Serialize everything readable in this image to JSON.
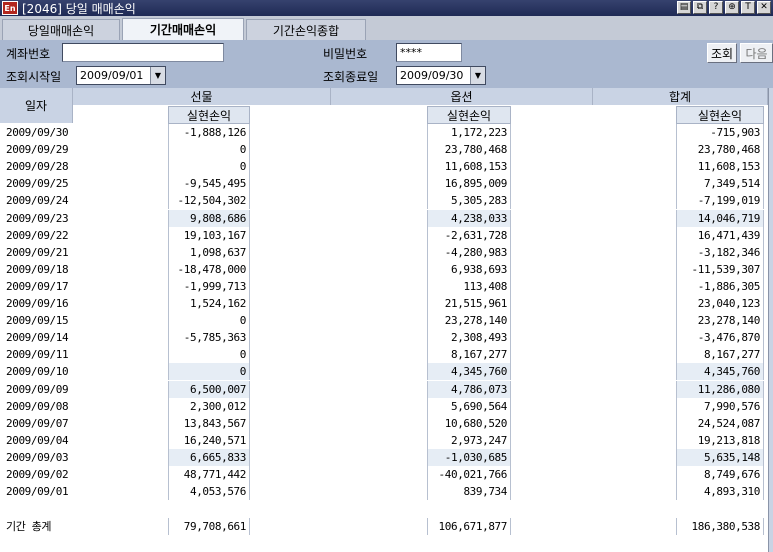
{
  "window": {
    "title": "[2046] 당일 매매손익",
    "logo": "En"
  },
  "tabs": [
    {
      "label": "당일매매손익"
    },
    {
      "label": "기간매매손익"
    },
    {
      "label": "기간손익종합"
    }
  ],
  "form": {
    "account_label": "계좌번호",
    "account_value": "",
    "password_label": "비밀번호",
    "password_value": "****",
    "start_label": "조회시작일",
    "start_value": "2009/09/01",
    "end_label": "조회종료일",
    "end_value": "2009/09/30",
    "search_button": "조회",
    "next_button": "다음"
  },
  "table": {
    "date_header": "일자",
    "group_headers": [
      "선물",
      "옵션",
      "합계"
    ],
    "sub_header": "실현손익",
    "rows": [
      {
        "date": "2009/09/30",
        "futures": "-1,888,126",
        "options": "1,172,223",
        "total": "-715,903"
      },
      {
        "date": "2009/09/29",
        "futures": "0",
        "options": "23,780,468",
        "total": "23,780,468"
      },
      {
        "date": "2009/09/28",
        "futures": "0",
        "options": "11,608,153",
        "total": "11,608,153"
      },
      {
        "date": "2009/09/25",
        "futures": "-9,545,495",
        "options": "16,895,009",
        "total": "7,349,514"
      },
      {
        "date": "2009/09/24",
        "futures": "-12,504,302",
        "options": "5,305,283",
        "total": "-7,199,019"
      },
      {
        "date": "2009/09/23",
        "futures": "9,808,686",
        "options": "4,238,033",
        "total": "14,046,719"
      },
      {
        "date": "2009/09/22",
        "futures": "19,103,167",
        "options": "-2,631,728",
        "total": "16,471,439"
      },
      {
        "date": "2009/09/21",
        "futures": "1,098,637",
        "options": "-4,280,983",
        "total": "-3,182,346"
      },
      {
        "date": "2009/09/18",
        "futures": "-18,478,000",
        "options": "6,938,693",
        "total": "-11,539,307"
      },
      {
        "date": "2009/09/17",
        "futures": "-1,999,713",
        "options": "113,408",
        "total": "-1,886,305"
      },
      {
        "date": "2009/09/16",
        "futures": "1,524,162",
        "options": "21,515,961",
        "total": "23,040,123"
      },
      {
        "date": "2009/09/15",
        "futures": "0",
        "options": "23,278,140",
        "total": "23,278,140"
      },
      {
        "date": "2009/09/14",
        "futures": "-5,785,363",
        "options": "2,308,493",
        "total": "-3,476,870"
      },
      {
        "date": "2009/09/11",
        "futures": "0",
        "options": "8,167,277",
        "total": "8,167,277"
      },
      {
        "date": "2009/09/10",
        "futures": "0",
        "options": "4,345,760",
        "total": "4,345,760"
      },
      {
        "date": "2009/09/09",
        "futures": "6,500,007",
        "options": "4,786,073",
        "total": "11,286,080"
      },
      {
        "date": "2009/09/08",
        "futures": "2,300,012",
        "options": "5,690,564",
        "total": "7,990,576"
      },
      {
        "date": "2009/09/07",
        "futures": "13,843,567",
        "options": "10,680,520",
        "total": "24,524,087"
      },
      {
        "date": "2009/09/04",
        "futures": "16,240,571",
        "options": "2,973,247",
        "total": "19,213,818"
      },
      {
        "date": "2009/09/03",
        "futures": "6,665,833",
        "options": "-1,030,685",
        "total": "5,635,148"
      },
      {
        "date": "2009/09/02",
        "futures": "48,771,442",
        "options": "-40,021,766",
        "total": "8,749,676"
      },
      {
        "date": "2009/09/01",
        "futures": "4,053,576",
        "options": "839,734",
        "total": "4,893,310"
      }
    ],
    "shaded_rows": [
      5,
      14,
      15,
      19
    ],
    "total_label": "기간 총계",
    "total_futures": "79,708,661",
    "total_options": "106,671,877",
    "total_total": "186,380,538"
  }
}
